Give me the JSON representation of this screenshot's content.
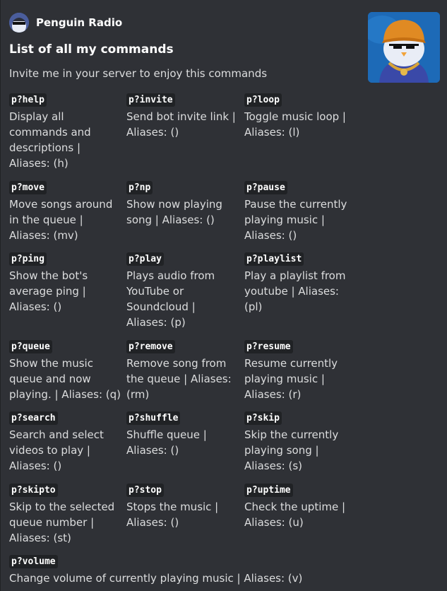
{
  "author": {
    "name": "Penguin Radio"
  },
  "title": "List of all my commands",
  "description": "Invite me in your server to enjoy this commands",
  "fields": [
    {
      "name": "p?help",
      "value": "Display all commands and descriptions | Aliases: (h)"
    },
    {
      "name": "p?invite",
      "value": "Send bot invite link | Aliases: ()"
    },
    {
      "name": "p?loop",
      "value": "Toggle music loop | Aliases: (l)"
    },
    {
      "name": "p?move",
      "value": "Move songs around in the queue | Aliases: (mv)"
    },
    {
      "name": "p?np",
      "value": "Show now playing song | Aliases: ()"
    },
    {
      "name": "p?pause",
      "value": "Pause the currently playing music | Aliases: ()"
    },
    {
      "name": "p?ping",
      "value": "Show the bot's average ping | Aliases: ()"
    },
    {
      "name": "p?play",
      "value": "Plays audio from YouTube or Soundcloud | Aliases: (p)"
    },
    {
      "name": "p?playlist",
      "value": "Play a playlist from youtube | Aliases: (pl)"
    },
    {
      "name": "p?queue",
      "value": "Show the music queue and now playing. | Aliases: (q)"
    },
    {
      "name": "p?remove",
      "value": "Remove song from the queue | Aliases: (rm)"
    },
    {
      "name": "p?resume",
      "value": "Resume currently playing music | Aliases: (r)"
    },
    {
      "name": "p?search",
      "value": "Search and select videos to play | Aliases: ()"
    },
    {
      "name": "p?shuffle",
      "value": "Shuffle queue | Aliases: ()"
    },
    {
      "name": "p?skip",
      "value": "Skip the currently playing song | Aliases: (s)"
    },
    {
      "name": "p?skipto",
      "value": "Skip to the selected queue number | Aliases: (st)"
    },
    {
      "name": "p?stop",
      "value": "Stops the music | Aliases: ()"
    },
    {
      "name": "p?uptime",
      "value": "Check the uptime | Aliases: (u)"
    },
    {
      "name": "p?volume",
      "value": "Change volume of currently playing music | Aliases: (v)"
    }
  ]
}
